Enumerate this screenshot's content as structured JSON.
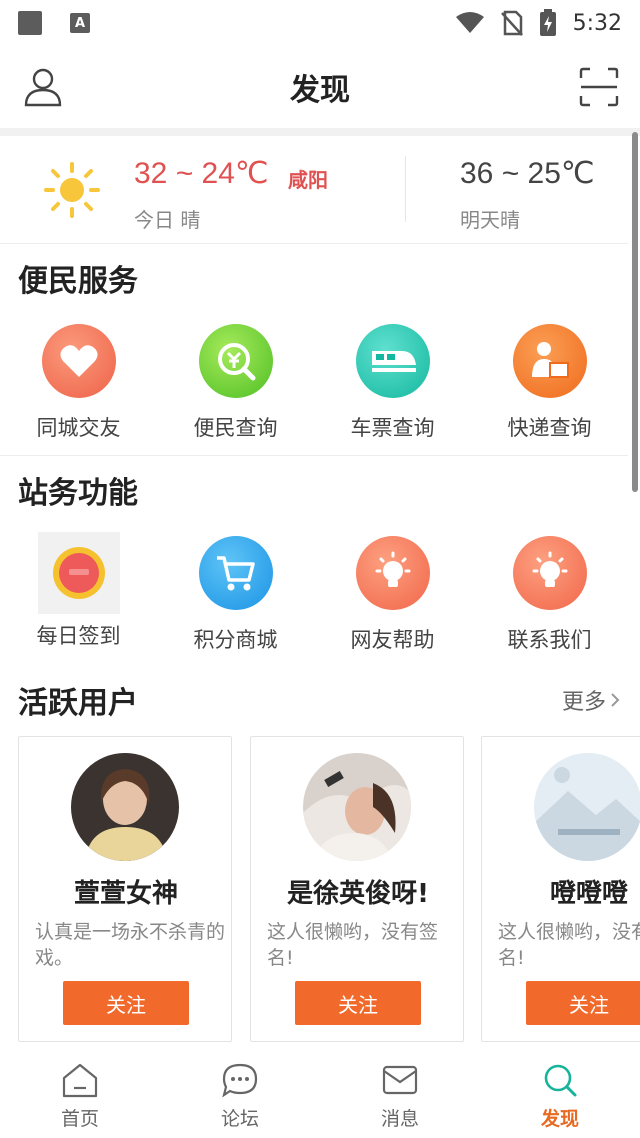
{
  "status_bar": {
    "time": "5:32"
  },
  "header": {
    "title": "发现"
  },
  "weather": {
    "today_range": "32 ~ 24℃",
    "today_city": "咸阳",
    "today_condition": "今日 晴",
    "tomorrow_range": "36 ~ 25℃",
    "tomorrow_condition": "明天晴"
  },
  "services": {
    "title": "便民服务",
    "items": [
      {
        "label": "同城交友",
        "icon": "heart-icon",
        "color": "#f0705a"
      },
      {
        "label": "便民查询",
        "icon": "search-coin-icon",
        "color": "#6fcf3a"
      },
      {
        "label": "车票查询",
        "icon": "train-icon",
        "color": "#2cc6b0"
      },
      {
        "label": "快递查询",
        "icon": "courier-icon",
        "color": "#f27a2e"
      }
    ]
  },
  "station": {
    "title": "站务功能",
    "items": [
      {
        "label": "每日签到",
        "icon": "checkin-badge-icon"
      },
      {
        "label": "积分商城",
        "icon": "cart-icon",
        "color": "#2fa8ee"
      },
      {
        "label": "网友帮助",
        "icon": "bulb-icon",
        "color": "#f57a5c"
      },
      {
        "label": "联系我们",
        "icon": "bulb-icon",
        "color": "#f57a5c"
      }
    ]
  },
  "active_users": {
    "title": "活跃用户",
    "more": "更多",
    "users": [
      {
        "name": "萱萱女神",
        "signature": "认真是一场永不杀青的戏。",
        "follow": "关注"
      },
      {
        "name": "是徐英俊呀!",
        "signature": "这人很懒哟，没有签名!",
        "follow": "关注"
      },
      {
        "name": "噔噔噔",
        "signature": "这人很懒哟，没有签名!",
        "follow": "关注"
      }
    ]
  },
  "bottom_nav": {
    "items": [
      {
        "label": "首页",
        "icon": "home-icon"
      },
      {
        "label": "论坛",
        "icon": "chat-bubble-icon"
      },
      {
        "label": "消息",
        "icon": "mail-icon"
      },
      {
        "label": "发现",
        "icon": "discover-search-icon"
      }
    ],
    "active": "发现"
  },
  "colors": {
    "accent": "#f26a2b",
    "weather_red": "#e05252"
  }
}
